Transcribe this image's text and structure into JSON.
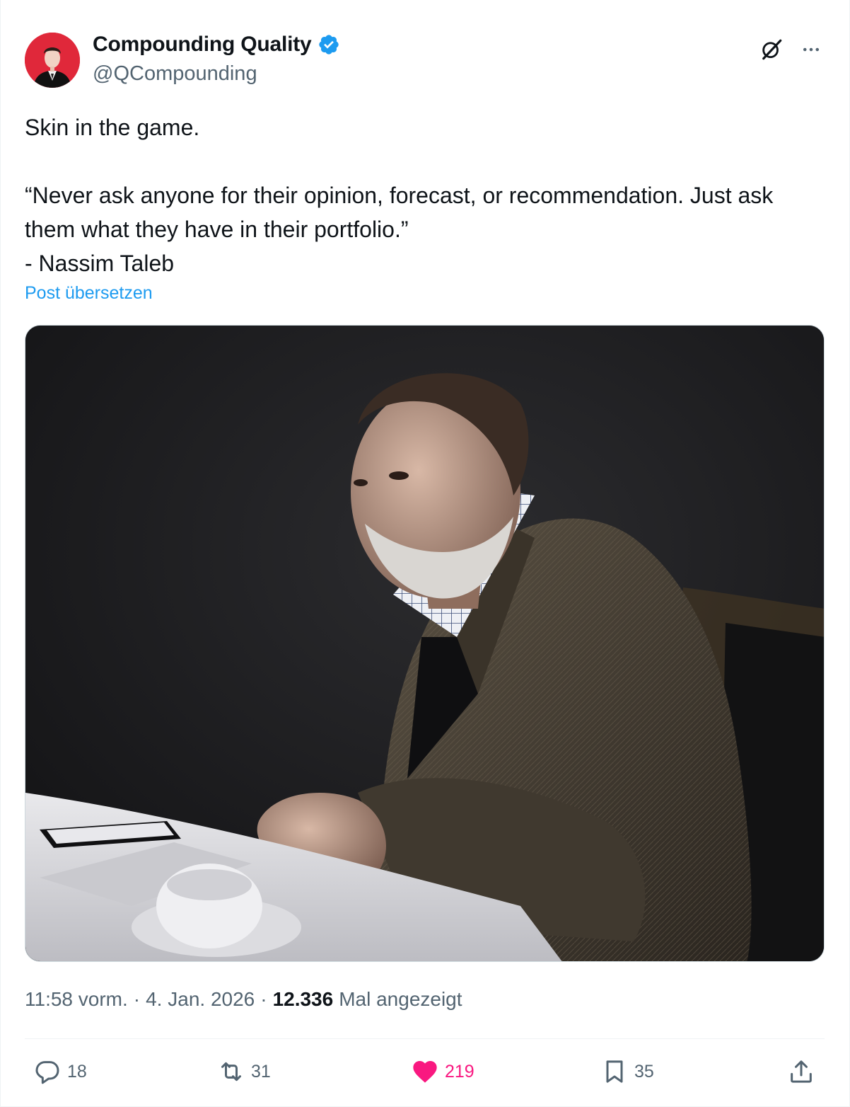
{
  "author": {
    "display_name": "Compounding Quality",
    "handle": "@QCompounding",
    "verified": true
  },
  "tweet": {
    "text": "Skin in the game.\n\n“Never ask anyone for their opinion, forecast, or recommendation. Just ask them what they have in their portfolio.”\n- Nassim Taleb",
    "translate_label": "Post übersetzen"
  },
  "meta": {
    "time": "11:58 vorm.",
    "sep1": "·",
    "date": "4. Jan. 2026",
    "sep2": "·",
    "views_count": "12.336",
    "views_label": "Mal angezeigt"
  },
  "actions": {
    "replies": "18",
    "reposts": "31",
    "likes": "219",
    "bookmarks": "35"
  },
  "colors": {
    "link": "#1d9bf0",
    "like": "#f91880",
    "muted": "#536471",
    "verified": "#1d9bf0",
    "avatar_bg": "#e0283a"
  },
  "icons": {
    "grok": "grok-icon",
    "more": "more-icon",
    "reply": "reply-icon",
    "repost": "repost-icon",
    "like": "heart-icon",
    "bookmark": "bookmark-icon",
    "share": "share-icon"
  }
}
